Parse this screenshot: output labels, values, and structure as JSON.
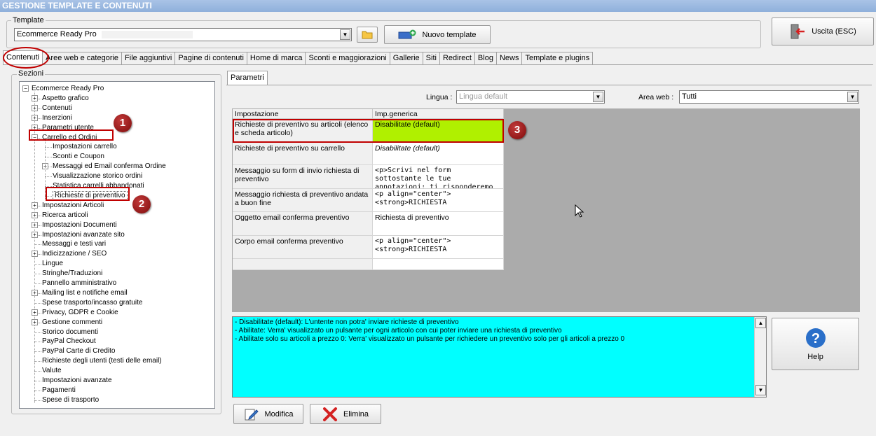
{
  "window": {
    "title": "GESTIONE TEMPLATE E CONTENUTI"
  },
  "template": {
    "group_label": "Template",
    "selected": "Ecommerce Ready Pro",
    "new_template_label": "Nuovo template",
    "exit_label": "Uscita (ESC)"
  },
  "tabs": [
    "Contenuti",
    "Aree web e categorie",
    "File aggiuntivi",
    "Pagine di contenuti",
    "Home di marca",
    "Sconti e maggiorazioni",
    "Gallerie",
    "Siti",
    "Redirect",
    "Blog",
    "News",
    "Template e plugins"
  ],
  "sections": {
    "label": "Sezioni",
    "root": "Ecommerce Ready Pro",
    "items": [
      {
        "label": "Aspetto grafico",
        "expandable": true
      },
      {
        "label": "Contenuti",
        "expandable": true
      },
      {
        "label": "Inserzioni",
        "expandable": true
      },
      {
        "label": "Parametri utente",
        "expandable": true
      },
      {
        "label": "Carrello ed Ordini",
        "expandable": true,
        "expanded": true
      },
      {
        "label": "Impostazioni carrello",
        "child": true
      },
      {
        "label": "Sconti e Coupon",
        "child": true
      },
      {
        "label": "Messaggi ed Email conferma Ordine",
        "child": true,
        "expandable": true
      },
      {
        "label": "Visualizzazione storico ordini",
        "child": true
      },
      {
        "label": "Statistica carrelli abbandonati",
        "child": true
      },
      {
        "label": "Richieste di preventivo",
        "child": true,
        "selected": true
      },
      {
        "label": "Impostazioni Articoli",
        "expandable": true
      },
      {
        "label": "Ricerca articoli",
        "expandable": true
      },
      {
        "label": "Impostazioni Documenti",
        "expandable": true
      },
      {
        "label": "Impostazioni avanzate sito",
        "expandable": true
      },
      {
        "label": "Messaggi e testi vari"
      },
      {
        "label": "Indicizzazione / SEO",
        "expandable": true
      },
      {
        "label": "Lingue"
      },
      {
        "label": "Stringhe/Traduzioni"
      },
      {
        "label": "Pannello amministrativo"
      },
      {
        "label": "Mailing list e notifiche email",
        "expandable": true
      },
      {
        "label": "Spese trasporto/incasso gratuite"
      },
      {
        "label": "Privacy, GDPR e Cookie",
        "expandable": true
      },
      {
        "label": "Gestione commenti",
        "expandable": true
      },
      {
        "label": "Storico documenti"
      },
      {
        "label": "PayPal Checkout"
      },
      {
        "label": "PayPal Carte di Credito"
      },
      {
        "label": "Richieste degli utenti (testi delle email)"
      },
      {
        "label": "Valute"
      },
      {
        "label": "Impostazioni avanzate"
      },
      {
        "label": "Pagamenti"
      },
      {
        "label": "Spese di trasporto"
      }
    ]
  },
  "params": {
    "tab_label": "Parametri",
    "lingua_label": "Lingua :",
    "lingua_value": "Lingua default",
    "area_label": "Area web :",
    "area_value": "Tutti",
    "col_setting": "Impostazione",
    "col_value": "Imp.generica",
    "rows": [
      {
        "key": "Richieste di preventivo su articoli (elenco e scheda articolo)",
        "value": "Disabilitate (default)"
      },
      {
        "key": "Richieste di preventivo su carrello",
        "value": "Disabilitate (default)"
      },
      {
        "key": "Messaggio su form di invio richiesta di preventivo",
        "value": "<p>Scrivi nel form sottostante le tue annotazioni; ti risponderemo appen..."
      },
      {
        "key": "Messaggio richiesta di preventivo andata a buon fine",
        "value": "<p align=\"center\"><strong>RICHIESTA"
      },
      {
        "key": "Oggetto email conferma preventivo",
        "value": "Richiesta di preventivo"
      },
      {
        "key": "Corpo email conferma preventivo",
        "value": "<p align=\"center\"><strong>RICHIESTA"
      }
    ]
  },
  "info_lines": [
    "- Disabilitate (default): L'untente non potra' inviare richieste di preventivo",
    "- Abilitate: Verra' visualizzato un pulsante per ogni articolo con cui poter inviare una richiesta di preventivo",
    "- Abilitate solo su articoli a prezzo 0: Verra' visualizzato un pulsante per richiedere un preventivo solo per gli articoli a prezzo 0"
  ],
  "buttons": {
    "help": "Help",
    "modify": "Modifica",
    "delete": "Elimina"
  },
  "badges": [
    "1",
    "2",
    "3"
  ],
  "colors": {
    "highlight_cell": "#b0f000",
    "info_bg": "#00ffff",
    "annotation": "#c00000"
  }
}
